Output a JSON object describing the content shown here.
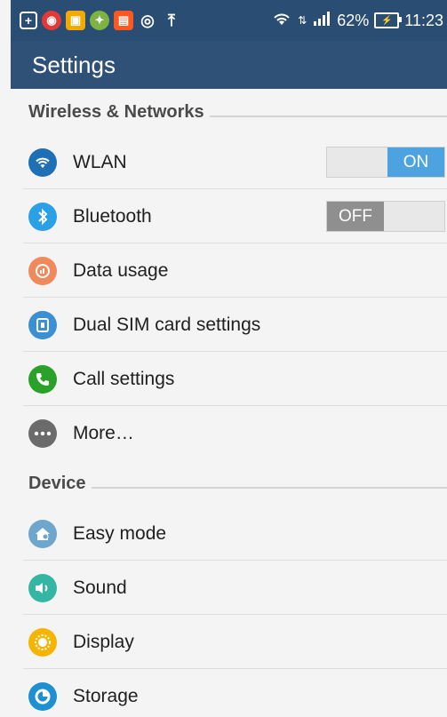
{
  "status_bar": {
    "battery": "62%",
    "time": "11:23"
  },
  "app": {
    "title": "Settings"
  },
  "sections": {
    "wireless": {
      "title": "Wireless & Networks"
    },
    "device": {
      "title": "Device"
    }
  },
  "wireless_items": {
    "wlan": {
      "label": "WLAN",
      "toggle": "ON",
      "color": "#1f6fb5"
    },
    "bluetooth": {
      "label": "Bluetooth",
      "toggle": "OFF",
      "color": "#2aa0e6"
    },
    "data_usage": {
      "label": "Data usage",
      "color": "#f08a5d"
    },
    "dual_sim": {
      "label": "Dual SIM card settings",
      "color": "#3b8fd3"
    },
    "call": {
      "label": "Call settings",
      "color": "#2aa22a"
    },
    "more": {
      "label": "More…",
      "color": "#6b6b6b"
    }
  },
  "device_items": {
    "easy_mode": {
      "label": "Easy mode",
      "color": "#6ea6cc"
    },
    "sound": {
      "label": "Sound",
      "color": "#34b6a4"
    },
    "display": {
      "label": "Display",
      "color": "#f4b400"
    },
    "storage": {
      "label": "Storage",
      "color": "#1e8fd0"
    }
  }
}
